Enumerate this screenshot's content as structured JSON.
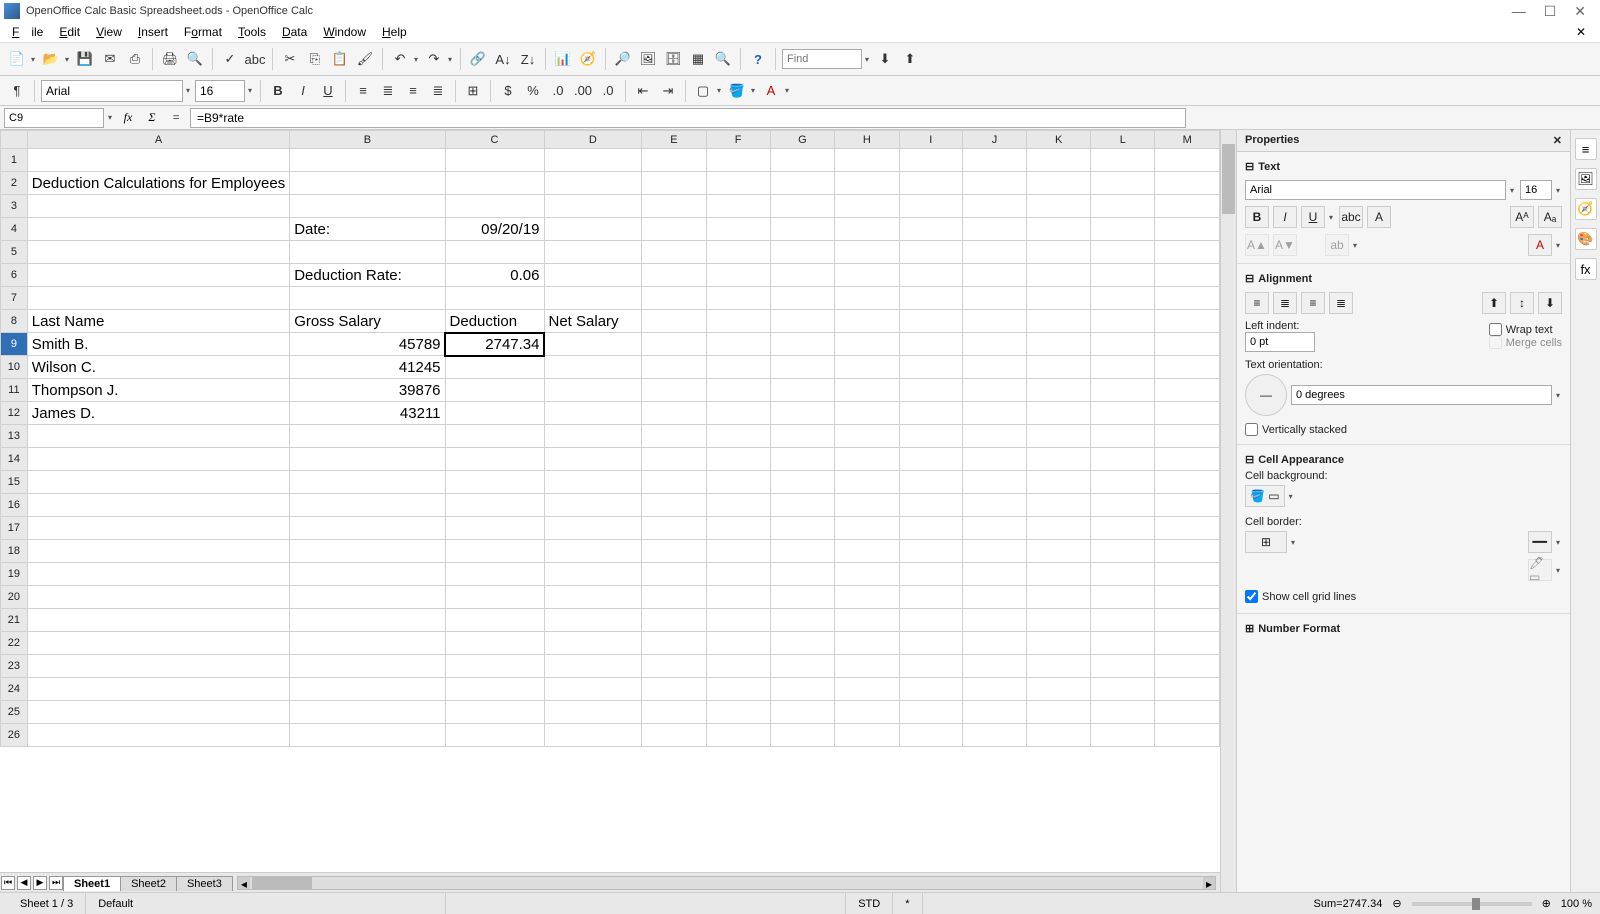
{
  "title": "OpenOffice Calc Basic Spreadsheet.ods - OpenOffice Calc",
  "menu": {
    "file": "File",
    "edit": "Edit",
    "view": "View",
    "insert": "Insert",
    "format": "Format",
    "tools": "Tools",
    "data": "Data",
    "window": "Window",
    "help": "Help"
  },
  "toolbar": {
    "find_placeholder": "Find"
  },
  "format": {
    "font": "Arial",
    "size": "16"
  },
  "formula": {
    "cell_ref": "C9",
    "value": "=B9*rate"
  },
  "columns": [
    "A",
    "B",
    "C",
    "D",
    "E",
    "F",
    "G",
    "H",
    "I",
    "J",
    "K",
    "L",
    "M"
  ],
  "rows": 26,
  "selected": {
    "row": 9,
    "col": "C"
  },
  "cells": {
    "A2": "Deduction Calculations for Employees",
    "B4": "Date:",
    "C4": "09/20/19",
    "B6": "Deduction Rate:",
    "C6": "0.06",
    "A8": "Last Name",
    "B8": "Gross Salary",
    "C8": "Deduction",
    "D8": "Net Salary",
    "A9": "Smith B.",
    "B9": "45789",
    "C9": "2747.34",
    "A10": "Wilson C.",
    "B10": "41245",
    "A11": "Thompson J.",
    "B11": "39876",
    "A12": "James D.",
    "B12": "43211"
  },
  "tabs": [
    "Sheet1",
    "Sheet2",
    "Sheet3"
  ],
  "active_tab": 0,
  "props": {
    "title": "Properties",
    "text_hdr": "Text",
    "align_hdr": "Alignment",
    "cell_hdr": "Cell Appearance",
    "num_hdr": "Number Format",
    "font": "Arial",
    "size": "16",
    "left_indent_lbl": "Left indent:",
    "left_indent": "0 pt",
    "wrap": "Wrap text",
    "merge": "Merge cells",
    "orient_lbl": "Text orientation:",
    "orient": "0 degrees",
    "vstack": "Vertically stacked",
    "bg_lbl": "Cell background:",
    "border_lbl": "Cell border:",
    "grid": "Show cell grid lines"
  },
  "status": {
    "sheet": "Sheet 1 / 3",
    "style": "Default",
    "mode": "STD",
    "star": "*",
    "sum": "Sum=2747.34",
    "zoom": "100 %"
  }
}
